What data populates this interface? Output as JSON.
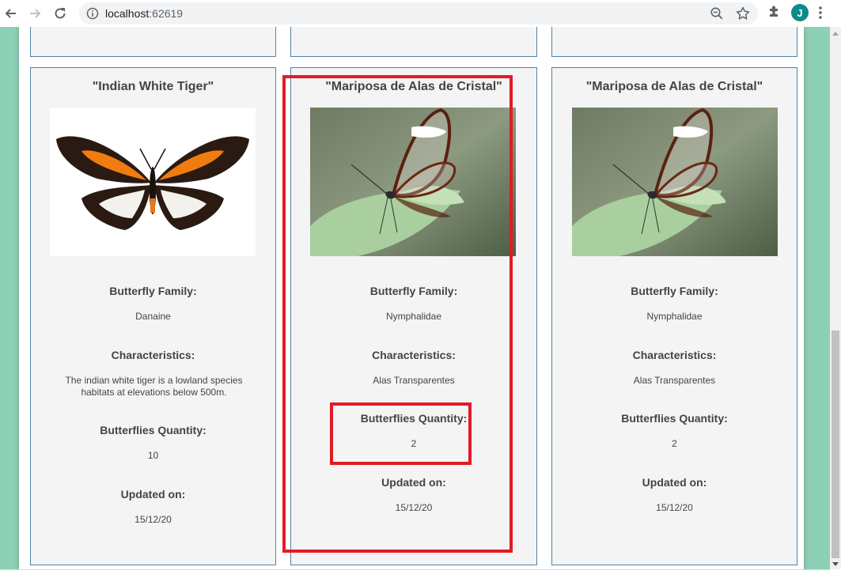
{
  "browser": {
    "url_host": "localhost",
    "url_port": ":62619",
    "profile_initial": "J"
  },
  "cards": [
    {
      "title": "\"Indian White Tiger\"",
      "family_label": "Butterfly Family:",
      "family": "Danaine",
      "characteristics_label": "Characteristics:",
      "characteristics": "The indian white tiger is a lowland species habitats at elevations below 500m.",
      "quantity_label": "Butterflies Quantity:",
      "quantity": "10",
      "updated_label": "Updated on:",
      "updated": "15/12/20"
    },
    {
      "title": "\"Mariposa de Alas de Cristal\"",
      "family_label": "Butterfly Family:",
      "family": "Nymphalidae",
      "characteristics_label": "Characteristics:",
      "characteristics": "Alas Transparentes",
      "quantity_label": "Butterflies Quantity:",
      "quantity": "2",
      "updated_label": "Updated on:",
      "updated": "15/12/20"
    },
    {
      "title": "\"Mariposa de Alas de Cristal\"",
      "family_label": "Butterfly Family:",
      "family": "Nymphalidae",
      "characteristics_label": "Characteristics:",
      "characteristics": "Alas Transparentes",
      "quantity_label": "Butterflies Quantity:",
      "quantity": "2",
      "updated_label": "Updated on:",
      "updated": "15/12/20"
    }
  ],
  "colors": {
    "page_background": "#8ed0b6",
    "card_background": "#f4f4f4",
    "card_border": "#4f83a8",
    "highlight": "#e21b26"
  }
}
